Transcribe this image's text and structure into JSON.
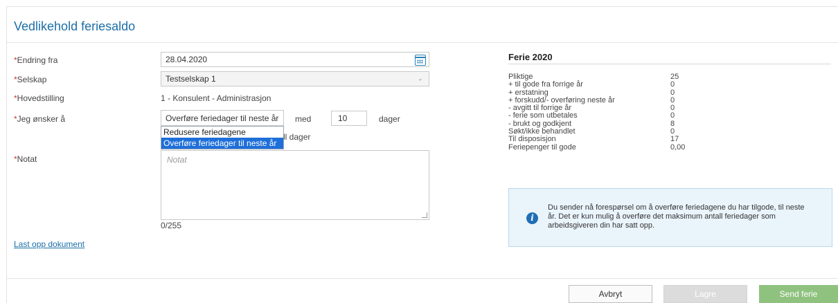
{
  "page": {
    "title": "Vedlikehold feriesaldo"
  },
  "form": {
    "required_mark": "*",
    "endring_label": "Endring fra",
    "endring_value": "28.04.2020",
    "selskap_label": "Selskap",
    "selskap_value": "Testselskap 1",
    "hovedstilling_label": "Hovedstilling",
    "hovedstilling_value": "1 - Konsulent - Administrasjon",
    "onsker_label": "Jeg ønsker å",
    "onsker_value": "Overføre feriedager til neste år",
    "med_label": "med",
    "days_value": "10",
    "dager_label": "dager",
    "behind_text": "ll dager",
    "dropdown_options": [
      "Redusere feriedagene",
      "Overføre feriedager til neste år"
    ],
    "notat_label": "Notat",
    "notat_placeholder": "Notat",
    "notat_counter": "0/255",
    "upload_link": "Last opp dokument"
  },
  "summary": {
    "title": "Ferie 2020",
    "rows": [
      {
        "label": "Pliktige",
        "value": "25"
      },
      {
        "label": "+ til gode fra forrige år",
        "value": "0"
      },
      {
        "label": "+ erstatning",
        "value": "0"
      },
      {
        "label": "+ forskudd/- overføring neste år",
        "value": "0"
      },
      {
        "label": "- avgitt til forrige år",
        "value": "0"
      },
      {
        "label": "- ferie som utbetales",
        "value": "0"
      },
      {
        "label": "- brukt og godkjent",
        "value": "8"
      },
      {
        "label": "Søkt/ikke behandlet",
        "value": "0"
      },
      {
        "label": "Til disposisjon",
        "value": "17"
      },
      {
        "label": "Feriepenger til gode",
        "value": "0,00"
      }
    ]
  },
  "info": {
    "text": "Du sender nå forespørsel om å overføre feriedagene du har tilgode, til neste år. Det er kun mulig å overføre det maksimum antall feriedager som arbeidsgiveren din har satt opp."
  },
  "footer": {
    "cancel": "Avbryt",
    "save": "Lagre",
    "send": "Send ferie"
  },
  "colors": {
    "title": "#1b6fa8",
    "required": "#c0392b",
    "info_bg": "#eaf4fb",
    "send_button": "#8fc27f",
    "dropdown_selected": "#1e6fd9"
  },
  "icons": [
    "calendar-icon",
    "chevron-down-icon",
    "info-icon",
    "resize-handle-icon"
  ]
}
